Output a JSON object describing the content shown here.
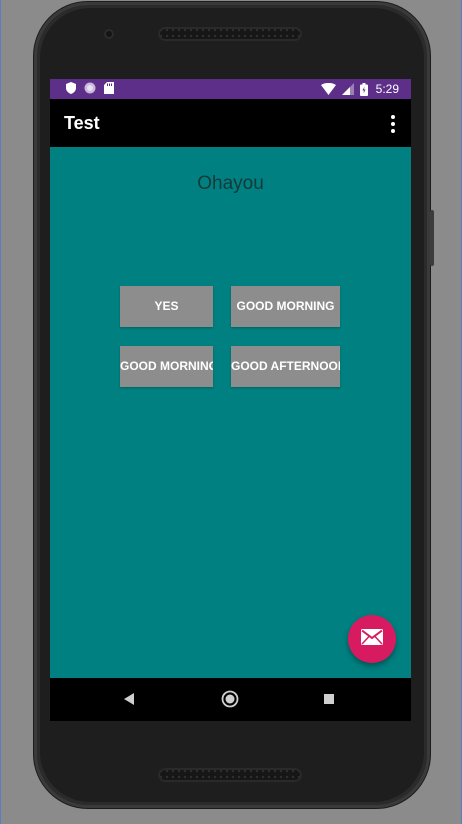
{
  "status_bar": {
    "time": "5:29",
    "color": "#5d2f89",
    "left_icons": [
      "shield-icon",
      "circle-icon",
      "sd-card-icon"
    ],
    "right_icons": [
      "wifi-icon",
      "signal-icon",
      "battery-icon"
    ]
  },
  "app_bar": {
    "title": "Test",
    "overflow_icon": "more-vert-icon"
  },
  "content": {
    "background": "#008080",
    "greeting": "Ohayou",
    "buttons": [
      {
        "label": "YES"
      },
      {
        "label": "GOOD MORNING"
      },
      {
        "label": "GOOD MORNING"
      },
      {
        "label": "GOOD AFTERNOON"
      }
    ]
  },
  "fab": {
    "icon": "mail-icon",
    "color": "#d81b60"
  },
  "nav_bar": {
    "icons": [
      "back-icon",
      "home-icon",
      "recents-icon"
    ]
  }
}
